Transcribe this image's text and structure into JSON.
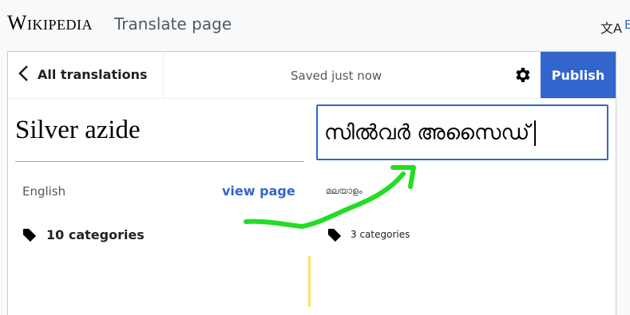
{
  "topbar": {
    "logo": "Wikipedia",
    "title": "Translate page",
    "lang_icon": "translate-icon",
    "lang_text": "E"
  },
  "header": {
    "back_label": "All translations",
    "back_icon": "chevron-left-icon",
    "status": "Saved just now",
    "settings_icon": "gear-icon",
    "publish_label": "Publish"
  },
  "source": {
    "title": "Silver azide",
    "language": "English",
    "view_page": "view page",
    "categories": "10 categories",
    "categories_icon": "tag-icon"
  },
  "target": {
    "title": "സിൽവർ അസൈഡ്",
    "language": "മലയാളം",
    "categories": "3 categories",
    "categories_icon": "tag-icon"
  },
  "colors": {
    "accent": "#3366cc",
    "annotation": "#22dd22",
    "highlight": "#fce36c"
  },
  "annotation_icon": "green-arrow-annotation"
}
